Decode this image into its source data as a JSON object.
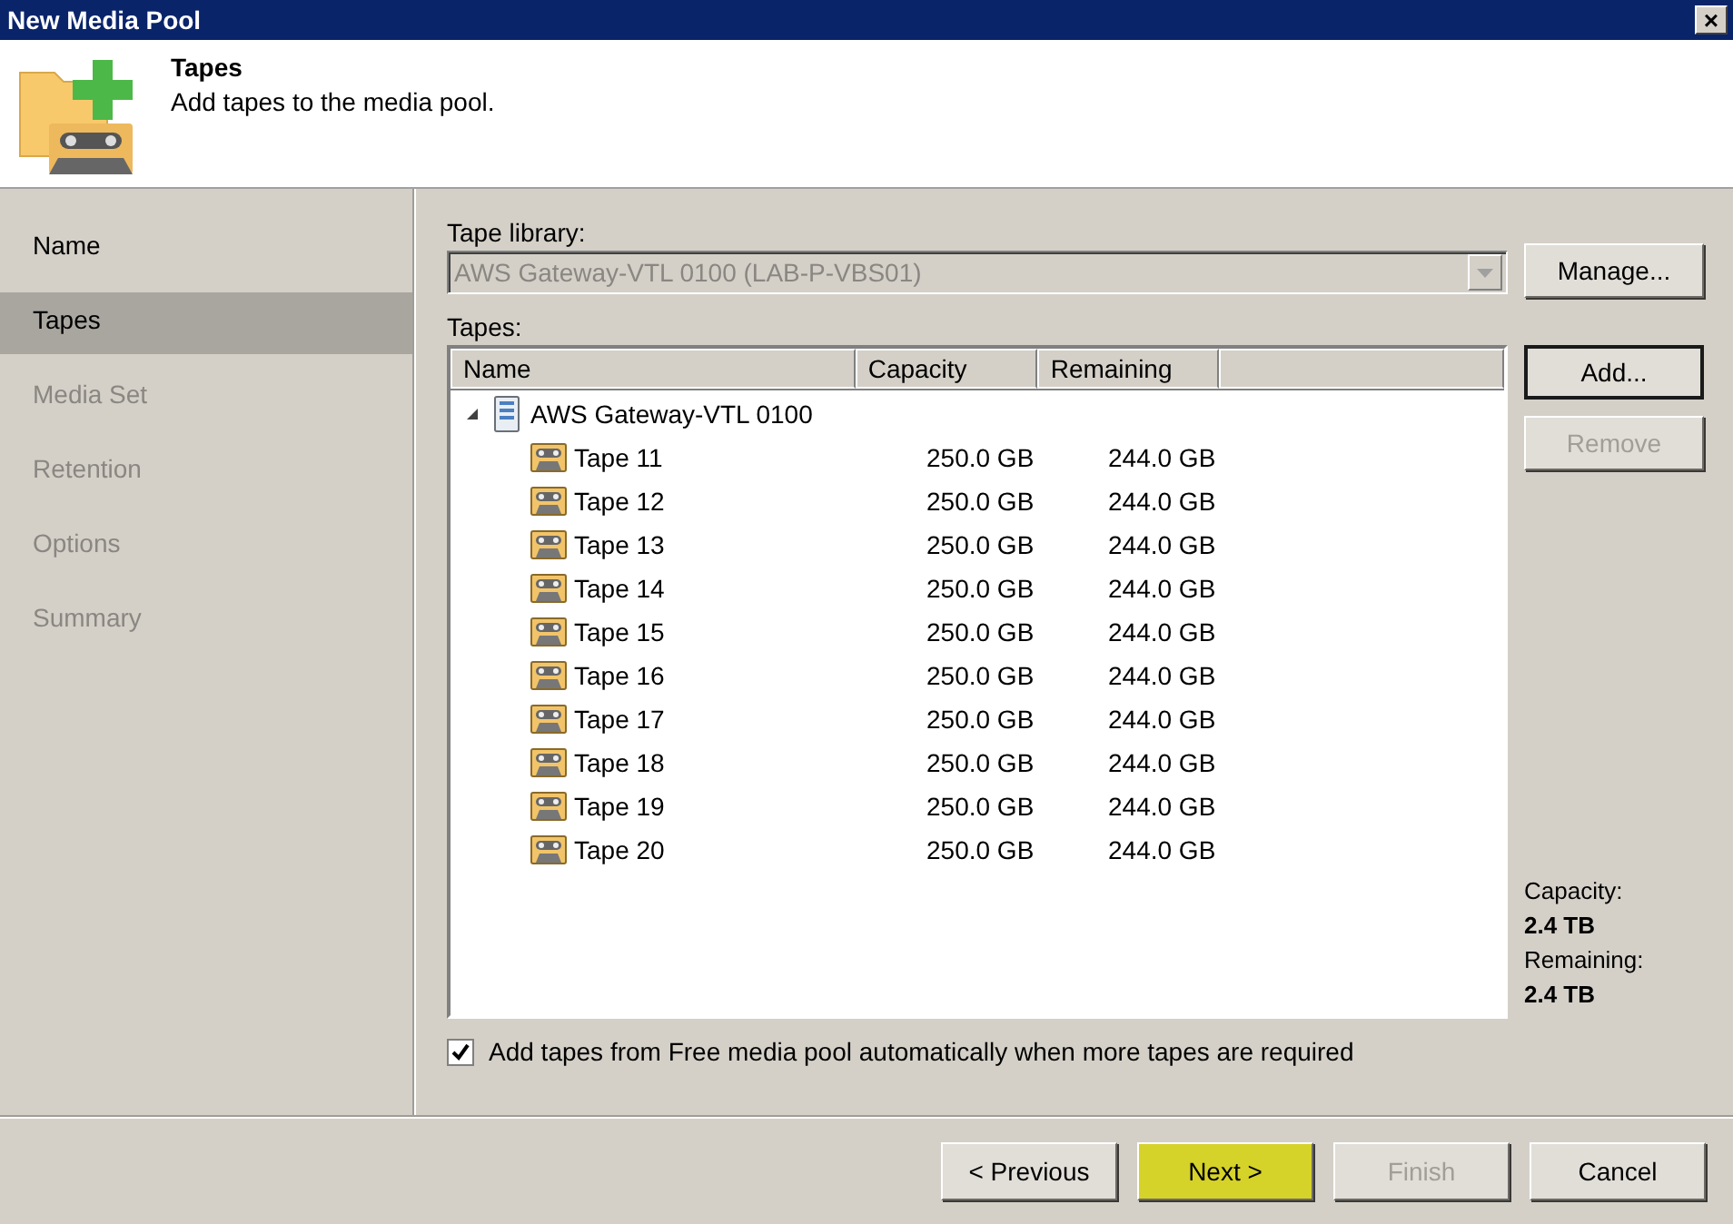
{
  "window": {
    "title": "New Media Pool",
    "close": "×"
  },
  "header": {
    "title": "Tapes",
    "subtitle": "Add tapes to the media pool."
  },
  "sidebar": {
    "items": [
      {
        "label": "Name",
        "selected": false,
        "disabled": false
      },
      {
        "label": "Tapes",
        "selected": true,
        "disabled": false
      },
      {
        "label": "Media Set",
        "selected": false,
        "disabled": true
      },
      {
        "label": "Retention",
        "selected": false,
        "disabled": true
      },
      {
        "label": "Options",
        "selected": false,
        "disabled": true
      },
      {
        "label": "Summary",
        "selected": false,
        "disabled": true
      }
    ]
  },
  "tape_library": {
    "label": "Tape library:",
    "value": "AWS Gateway-VTL 0100 (LAB-P-VBS01)",
    "disabled": true
  },
  "manage_button": {
    "label": "Manage...",
    "disabled": false,
    "default": false
  },
  "tapes": {
    "label": "Tapes:",
    "columns": [
      "Name",
      "Capacity",
      "Remaining"
    ],
    "tree": [
      {
        "name": "AWS Gateway-VTL 0100",
        "expanded": true,
        "children": [
          {
            "name": "Tape 11",
            "capacity": "250.0 GB",
            "remaining": "244.0 GB"
          },
          {
            "name": "Tape 12",
            "capacity": "250.0 GB",
            "remaining": "244.0 GB"
          },
          {
            "name": "Tape 13",
            "capacity": "250.0 GB",
            "remaining": "244.0 GB"
          },
          {
            "name": "Tape 14",
            "capacity": "250.0 GB",
            "remaining": "244.0 GB"
          },
          {
            "name": "Tape 15",
            "capacity": "250.0 GB",
            "remaining": "244.0 GB"
          },
          {
            "name": "Tape 16",
            "capacity": "250.0 GB",
            "remaining": "244.0 GB"
          },
          {
            "name": "Tape 17",
            "capacity": "250.0 GB",
            "remaining": "244.0 GB"
          },
          {
            "name": "Tape 18",
            "capacity": "250.0 GB",
            "remaining": "244.0 GB"
          },
          {
            "name": "Tape 19",
            "capacity": "250.0 GB",
            "remaining": "244.0 GB"
          },
          {
            "name": "Tape 20",
            "capacity": "250.0 GB",
            "remaining": "244.0 GB"
          }
        ]
      }
    ]
  },
  "side_buttons": [
    {
      "label": "Add...",
      "disabled": false,
      "default": true
    },
    {
      "label": "Remove",
      "disabled": true,
      "default": false
    }
  ],
  "totals": [
    {
      "label": "Capacity:",
      "value": "2.4 TB"
    },
    {
      "label": "Remaining:",
      "value": "2.4 TB"
    }
  ],
  "auto_add": {
    "label": "Add tapes from Free media pool automatically when more tapes are required",
    "checked": true
  },
  "footer_buttons": [
    {
      "label": "< Previous",
      "disabled": false,
      "highlighted": false
    },
    {
      "label": "Next >",
      "disabled": false,
      "highlighted": true
    },
    {
      "label": "Finish",
      "disabled": true,
      "highlighted": false
    },
    {
      "label": "Cancel",
      "disabled": false,
      "highlighted": false
    }
  ]
}
